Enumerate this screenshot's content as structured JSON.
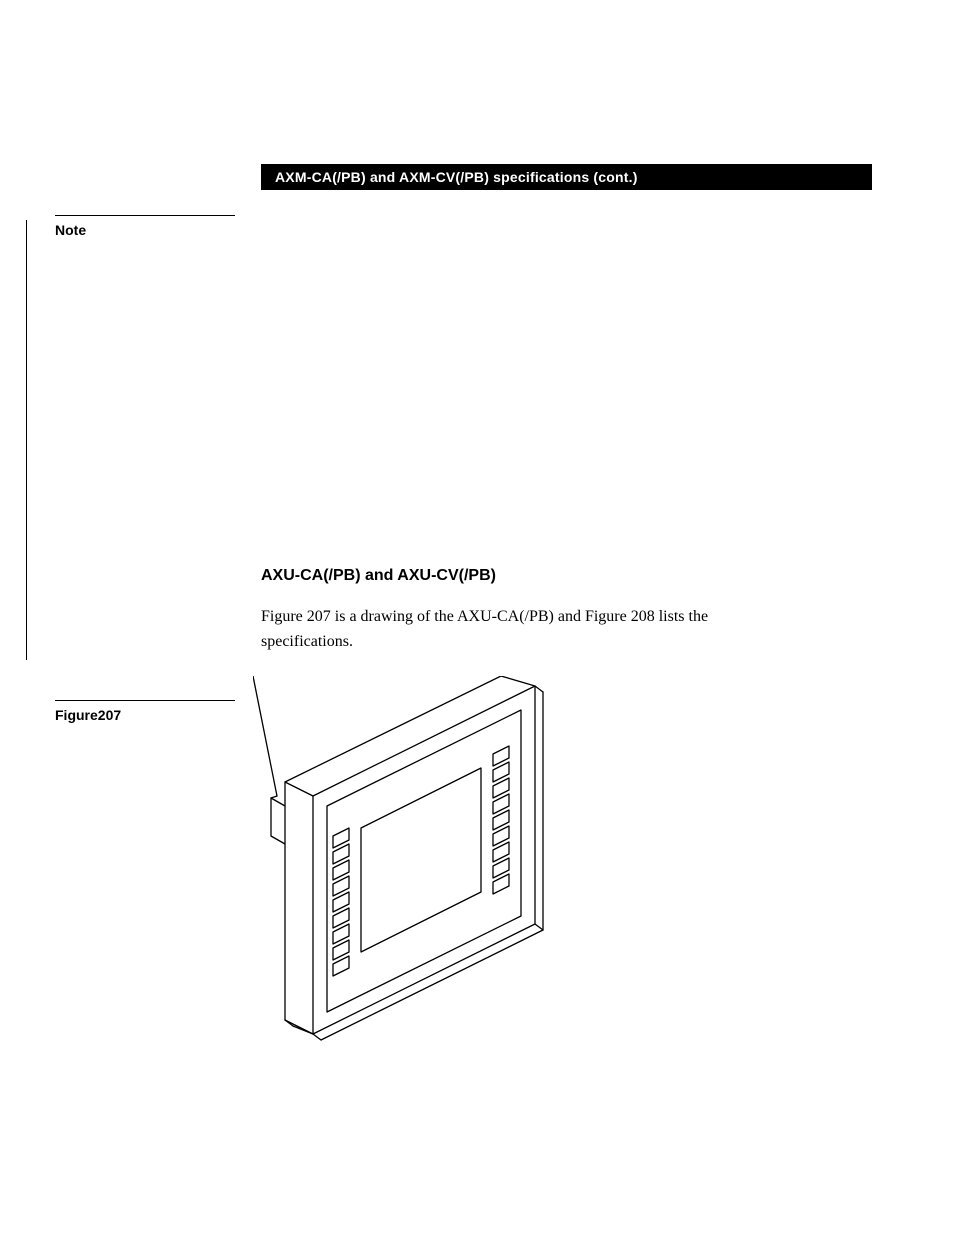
{
  "header": {
    "title": "AXM-CA(/PB) and AXM-CV(/PB) specifications (cont.)"
  },
  "sidebar": {
    "note_label": "Note",
    "figure_label": "Figure207"
  },
  "section": {
    "heading": "AXU-CA(/PB) and AXU-CV(/PB)",
    "body": "Figure 207 is a drawing of the AXU-CA(/PB) and Figure 208 lists the specifications."
  }
}
